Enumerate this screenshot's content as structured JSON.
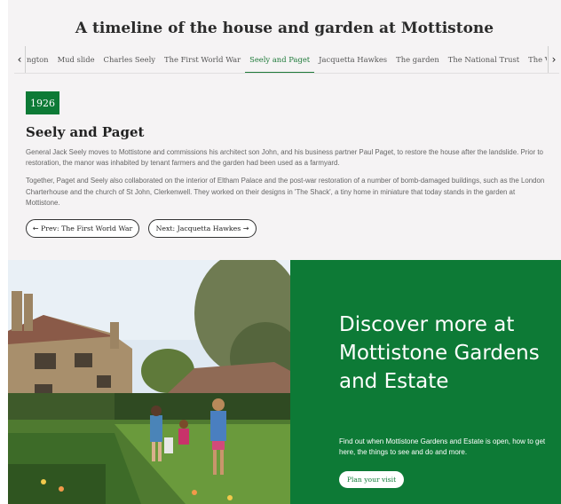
{
  "timeline": {
    "heading": "A timeline of the house and garden at Mottistone",
    "tabs": [
      {
        "label": "ngton"
      },
      {
        "label": "Mud slide"
      },
      {
        "label": "Charles Seely"
      },
      {
        "label": "The First World War"
      },
      {
        "label": "Seely and Paget"
      },
      {
        "label": "Jacquetta Hawkes"
      },
      {
        "label": "The garden"
      },
      {
        "label": "The National Trust"
      },
      {
        "label": "The Victoria Cros"
      }
    ],
    "active_tab": "Seely and Paget",
    "prev_arrow": "‹",
    "next_arrow": "›"
  },
  "entry": {
    "year": "1926",
    "title": "Seely and Paget",
    "paragraphs": [
      "General Jack Seely moves to Mottistone and commissions his architect son John, and his business partner Paul Paget, to restore the house after the landslide. Prior to restoration, the manor was inhabited by tenant farmers and the garden had been used as a farmyard.",
      "Together, Paget and Seely also collaborated on the interior of Eltham Palace and the post-war restoration of a number of bomb-damaged buildings, such as the London Charterhouse and the church of St John, Clerkenwell. They worked on their designs in 'The Shack', a tiny home in miniature that today stands in the garden at Mottistone."
    ],
    "prev_button": {
      "arrow": "←",
      "label": "Prev: The First World War"
    },
    "next_button": {
      "label": "Next: Jacquetta Hawkes",
      "arrow": "→"
    }
  },
  "cta": {
    "title": "Discover more at Mottistone Gardens and Estate",
    "text": "Find out when Mottistone Gardens and Estate is open, how to get here, the things to see and do and more.",
    "button": "Plan your visit"
  },
  "colors": {
    "brand_green": "#0d7a36",
    "active_tab": "#1f7a3a",
    "section_bg": "#f5f3f4"
  }
}
